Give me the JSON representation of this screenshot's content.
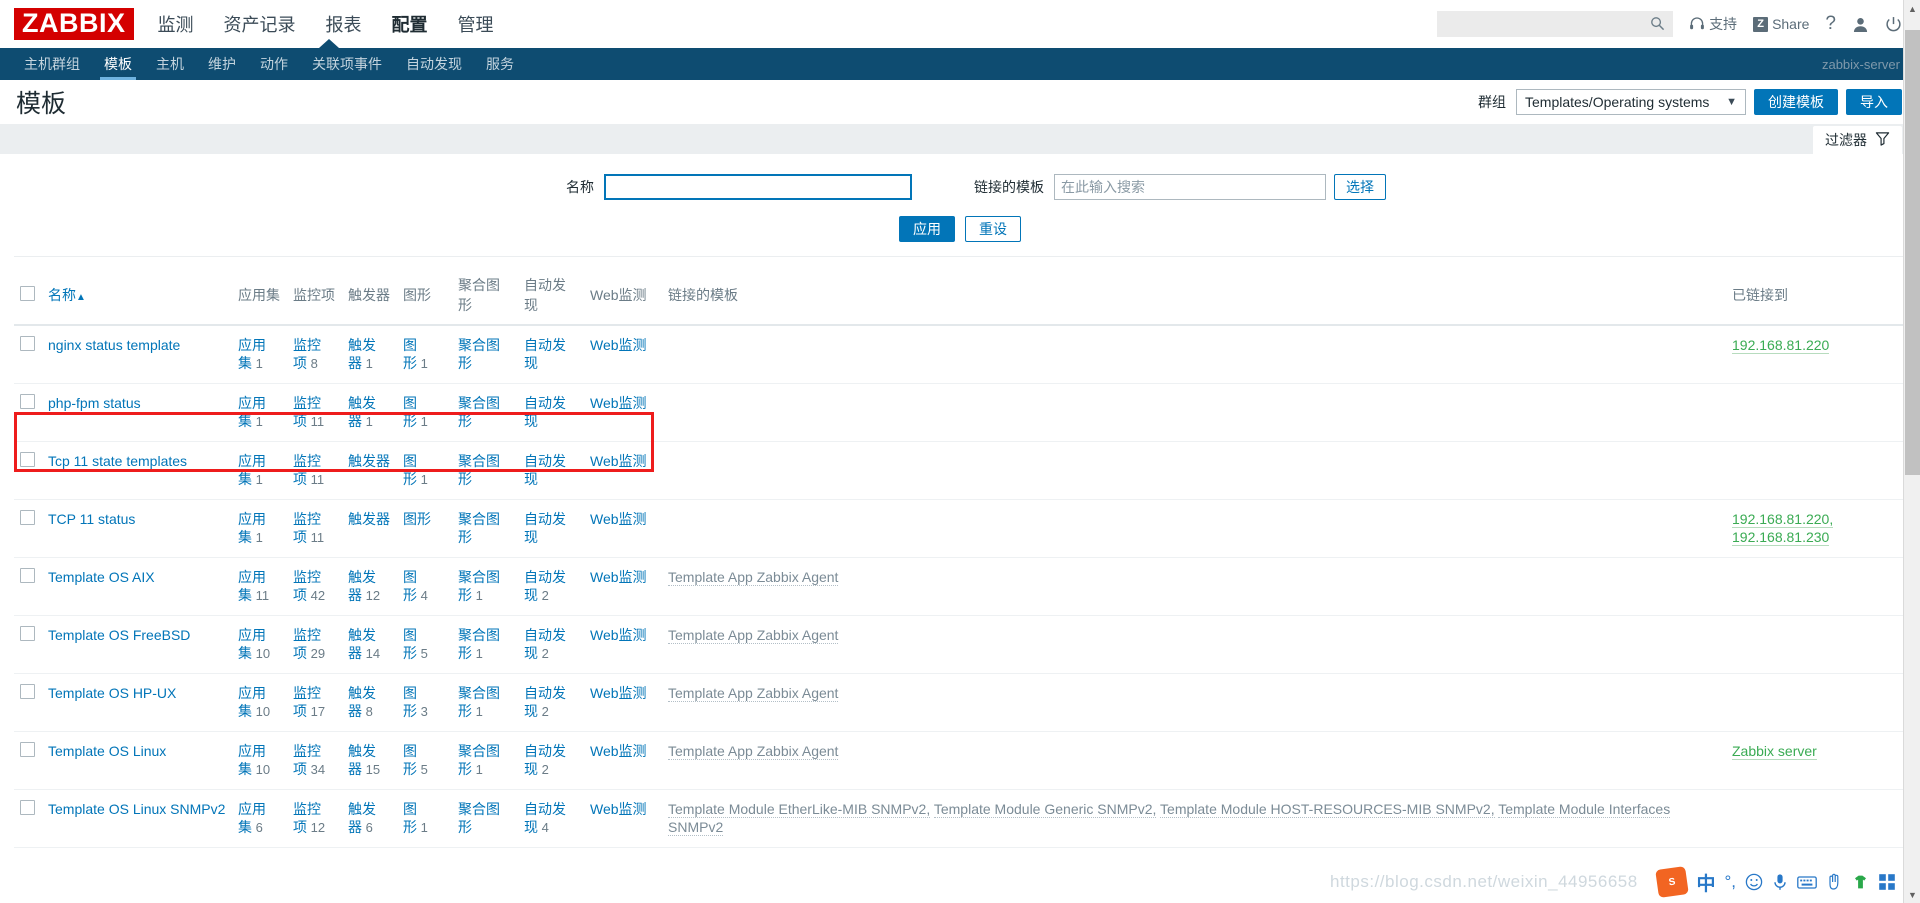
{
  "header": {
    "logo": "ZABBIX",
    "nav": [
      {
        "label": "监测",
        "active": false
      },
      {
        "label": "资产记录",
        "active": false
      },
      {
        "label": "报表",
        "active": false
      },
      {
        "label": "配置",
        "active": true
      },
      {
        "label": "管理",
        "active": false
      }
    ],
    "search_value": "",
    "search_placeholder": "",
    "support_label": "支持",
    "share_label": "Share",
    "share_badge": "Z",
    "help_label": "?",
    "user_icon": "user-icon",
    "power_icon": "power-icon"
  },
  "subnav": {
    "items": [
      {
        "label": "主机群组",
        "active": false
      },
      {
        "label": "模板",
        "active": true
      },
      {
        "label": "主机",
        "active": false
      },
      {
        "label": "维护",
        "active": false
      },
      {
        "label": "动作",
        "active": false
      },
      {
        "label": "关联项事件",
        "active": false
      },
      {
        "label": "自动发现",
        "active": false
      },
      {
        "label": "服务",
        "active": false
      }
    ],
    "server_name": "zabbix-server"
  },
  "page": {
    "title": "模板",
    "group_label": "群组",
    "group_value": "Templates/Operating systems",
    "create_button": "创建模板",
    "import_button": "导入",
    "filter_tab_label": "过滤器"
  },
  "filter": {
    "name_label": "名称",
    "name_value": "",
    "linked_template_label": "链接的模板",
    "linked_template_value": "",
    "linked_template_placeholder": "在此输入搜索",
    "select_button": "选择",
    "apply_button": "应用",
    "reset_button": "重设"
  },
  "table": {
    "columns": {
      "name": "名称",
      "sort_indicator": "▲",
      "applications": "应用集",
      "items": "监控项",
      "triggers": "触发器",
      "graphs": "图形",
      "screens": "聚合图形",
      "discovery": "自动发现",
      "web": "Web监测",
      "linked_templates": "链接的模板",
      "linked_to": "已链接到"
    },
    "label_parts": {
      "applications": [
        "应用",
        "集"
      ],
      "items": [
        "监控",
        "项"
      ],
      "triggers": [
        "触发",
        "器"
      ],
      "graphs": [
        "图",
        "形"
      ],
      "screens": [
        "聚合图",
        "形"
      ],
      "discovery": [
        "自动发",
        "现"
      ],
      "web": "Web监测"
    },
    "rows": [
      {
        "name": "nginx status template",
        "applications": "1",
        "items": "8",
        "triggers": "1",
        "graphs": "1",
        "screens": "",
        "discovery": "",
        "web": "",
        "screens_inline": "聚合图形",
        "discovery_inline": "自动发现",
        "linked_templates": [],
        "linked_to": [
          "192.168.81.220"
        ],
        "highlighted": false
      },
      {
        "name": "php-fpm status",
        "applications": "1",
        "items": "11",
        "triggers": "1",
        "graphs": "1",
        "screens": "",
        "discovery": "",
        "web": "",
        "screens_inline": "聚合图形",
        "discovery_inline": "自动发现",
        "linked_templates": [],
        "linked_to": [],
        "highlighted": true
      },
      {
        "name": "Tcp 11 state templates",
        "applications": "1",
        "items": "11",
        "triggers": "",
        "graphs": "1",
        "screens": "",
        "discovery": "",
        "web": "",
        "screens_inline": "聚合图形",
        "discovery_inline": "自动发现",
        "triggers_inline": "触发器",
        "linked_templates": [],
        "linked_to": [],
        "highlighted": false
      },
      {
        "name": "TCP 11 status",
        "applications": "1",
        "items": "11",
        "triggers": "",
        "graphs": "",
        "screens": "",
        "discovery": "",
        "web": "",
        "triggers_inline": "触发器",
        "graphs_inline": "图形",
        "screens_inline": "聚合图形",
        "discovery_inline": "自动发现",
        "linked_templates": [],
        "linked_to": [
          "192.168.81.220,",
          "192.168.81.230"
        ],
        "highlighted": false
      },
      {
        "name": "Template OS AIX",
        "applications": "11",
        "items": "42",
        "triggers": "12",
        "graphs": "4",
        "screens": "1",
        "discovery": "2",
        "web": "",
        "linked_templates": [
          "Template App Zabbix Agent"
        ],
        "linked_to": [],
        "highlighted": false
      },
      {
        "name": "Template OS FreeBSD",
        "applications": "10",
        "items": "29",
        "triggers": "14",
        "graphs": "5",
        "screens": "1",
        "discovery": "2",
        "web": "",
        "linked_templates": [
          "Template App Zabbix Agent"
        ],
        "linked_to": [],
        "highlighted": false
      },
      {
        "name": "Template OS HP-UX",
        "applications": "10",
        "items": "17",
        "triggers": "8",
        "graphs": "3",
        "screens": "1",
        "discovery": "2",
        "web": "",
        "linked_templates": [
          "Template App Zabbix Agent"
        ],
        "linked_to": [],
        "highlighted": false
      },
      {
        "name": "Template OS Linux",
        "applications": "10",
        "items": "34",
        "triggers": "15",
        "graphs": "5",
        "screens": "1",
        "discovery": "2",
        "web": "",
        "linked_templates": [
          "Template App Zabbix Agent"
        ],
        "linked_to": [
          "Zabbix server"
        ],
        "highlighted": false
      },
      {
        "name": "Template OS Linux SNMPv2",
        "applications": "6",
        "items": "12",
        "triggers": "6",
        "graphs": "1",
        "screens": "",
        "discovery": "4",
        "web": "",
        "screens_inline": "聚合图形",
        "linked_templates": [
          "Template Module EtherLike-MIB SNMPv2,",
          "Template Module Generic SNMPv2,",
          "Template Module HOST-RESOURCES-MIB SNMPv2,",
          "Template Module Interfaces SNMPv2"
        ],
        "linked_to": [],
        "highlighted": false
      }
    ]
  },
  "watermark": {
    "text": "https://blog.csdn.net/weixin_44956658"
  },
  "ime": {
    "logo": "S",
    "mode": "中",
    "punct": "°,",
    "emoji": "☺",
    "mic": "mic-icon",
    "keyboard": "keyboard-icon",
    "hand": "hand-icon",
    "skin": "skin-icon",
    "apps": "apps-icon"
  },
  "scrollbar": {
    "up": "▲",
    "down": "▼"
  }
}
